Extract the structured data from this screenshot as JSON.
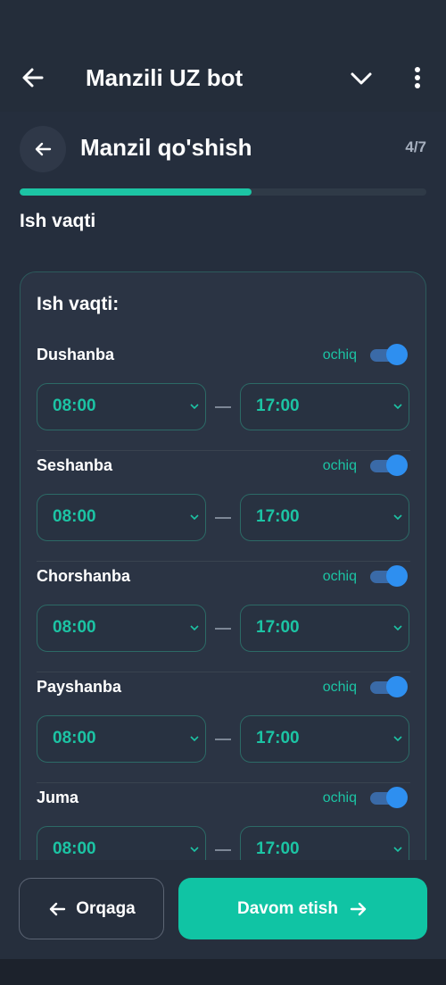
{
  "app_bar": {
    "title": "Manzili UZ bot",
    "back_icon": "arrow-left-icon",
    "menu_icon": "chevron-down-icon",
    "more_icon": "more-vertical-icon"
  },
  "header": {
    "title": "Manzil qo'shish",
    "step": "4/7",
    "progress": 0.57
  },
  "section_title": "Ish vaqti",
  "card": {
    "title": "Ish vaqti:",
    "days": [
      {
        "name": "Dushanba",
        "status": "ochiq",
        "enabled": true,
        "from": "08:00",
        "to": "17:00"
      },
      {
        "name": "Seshanba",
        "status": "ochiq",
        "enabled": true,
        "from": "08:00",
        "to": "17:00"
      },
      {
        "name": "Chorshanba",
        "status": "ochiq",
        "enabled": true,
        "from": "08:00",
        "to": "17:00"
      },
      {
        "name": "Payshanba",
        "status": "ochiq",
        "enabled": true,
        "from": "08:00",
        "to": "17:00"
      },
      {
        "name": "Juma",
        "status": "ochiq",
        "enabled": true,
        "from": "08:00",
        "to": "17:00"
      }
    ]
  },
  "footer": {
    "back_label": "Orqaga",
    "next_label": "Davom etish"
  },
  "colors": {
    "accent": "#1cc4a4",
    "toggle_on": "#2e8ff0",
    "background": "#252e3d"
  }
}
